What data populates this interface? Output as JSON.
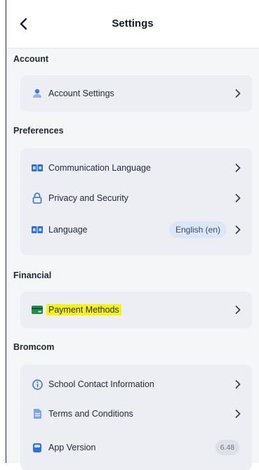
{
  "header": {
    "title": "Settings",
    "back_icon": "chevron-left-icon"
  },
  "sections": {
    "account": {
      "title": "Account",
      "items": [
        {
          "label": "Account Settings",
          "icon": "user-icon"
        }
      ]
    },
    "preferences": {
      "title": "Preferences",
      "items": [
        {
          "label": "Communication Language",
          "icon": "flag-icon"
        },
        {
          "label": "Privacy and Security",
          "icon": "lock-icon"
        },
        {
          "label": "Language",
          "icon": "flag-icon",
          "value": "English (en)"
        }
      ]
    },
    "financial": {
      "title": "Financial",
      "items": [
        {
          "label": "Payment Methods",
          "icon": "card-icon",
          "highlight": "#f7f309"
        }
      ]
    },
    "bromcom": {
      "title": "Bromcom",
      "items": [
        {
          "label": "School Contact Information",
          "icon": "info-icon"
        },
        {
          "label": "Terms and Conditions",
          "icon": "document-icon"
        },
        {
          "label": "App Version",
          "icon": "device-icon",
          "value": "6.48"
        }
      ]
    }
  },
  "colors": {
    "accent": "#2f6fe4",
    "card": "#eceef3",
    "background": "#f5f6f8",
    "pill": "#dbe6f6"
  }
}
